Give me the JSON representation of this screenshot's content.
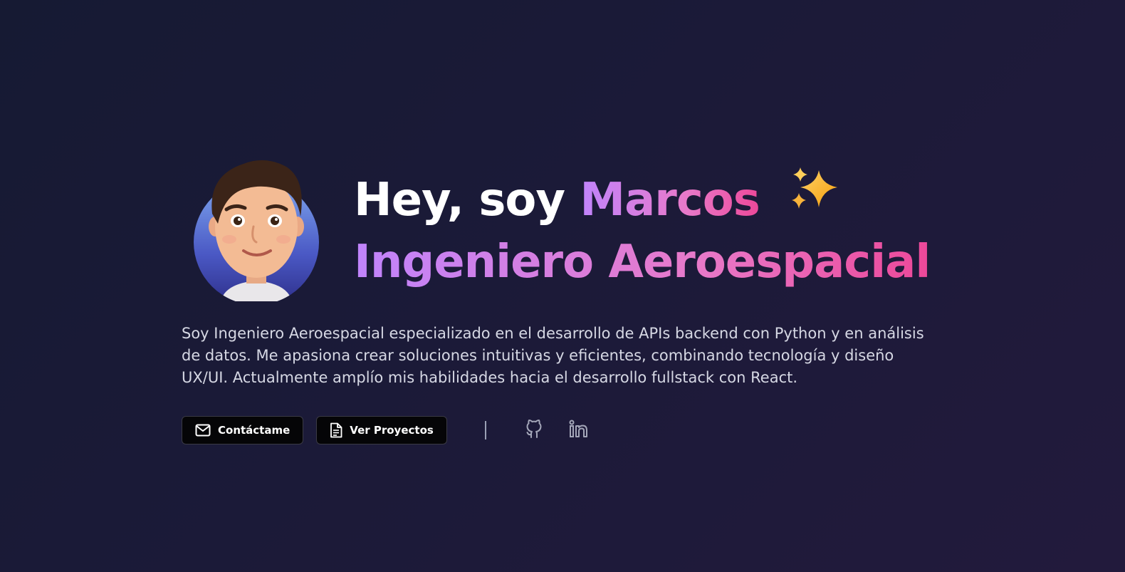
{
  "hero": {
    "greeting": "Hey, soy",
    "name": "Marcos",
    "sparkles": "✨",
    "role": "Ingeniero Aeroespacial",
    "description": "Soy Ingeniero Aeroespacial especializado en el desarrollo de APIs backend con Python y en análisis de datos. Me apasiona crear soluciones intuitivas y eficientes, combinando tecnología y diseño UX/UI. Actualmente amplío mis habilidades hacia el desarrollo fullstack con React."
  },
  "actions": {
    "contact_label": "Contáctame",
    "projects_label": "Ver Proyectos"
  },
  "social": {
    "github_icon": "github-icon",
    "linkedin_icon": "linkedin-icon"
  },
  "colors": {
    "background": "#1b1a38",
    "gradient_start": "#c084fc",
    "gradient_end": "#ec4899",
    "button_bg": "#050507"
  }
}
